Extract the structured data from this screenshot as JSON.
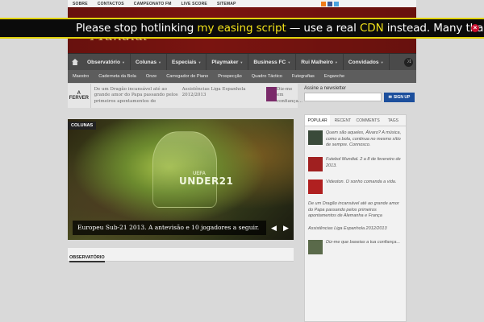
{
  "topbar": {
    "links": [
      "SOBRE",
      "CONTACTOS",
      "CAMPEONATO FM",
      "LIVE SCORE",
      "SITEMAP"
    ],
    "social_icons": [
      {
        "name": "rss-icon",
        "color": "#f07b1a"
      },
      {
        "name": "facebook-icon",
        "color": "#3b5998"
      },
      {
        "name": "twitter-icon",
        "color": "#4aa3df"
      }
    ]
  },
  "header": {
    "logo_text": "Mundial"
  },
  "banner": {
    "part1": "Please stop hotlinking ",
    "link1": "my easing script",
    "part2": " — use a real ",
    "link2": "CDN",
    "part3": " instead. Many thanks",
    "close": "×"
  },
  "nav": {
    "items": [
      "Observatório",
      "Colunas",
      "Especiais",
      "Playmaker",
      "Business FC",
      "Rui Malheiro",
      "Convidados"
    ]
  },
  "subnav": {
    "items": [
      "Maestro",
      "Caderneta da Bola",
      "Onze",
      "Carregador de Piano",
      "Prospecção",
      "Quadro Táctico",
      "Futegrafias",
      "Enganche"
    ]
  },
  "ticker": {
    "label_a": "A",
    "label_b": "FERVER",
    "items": [
      "De um Dragão incansável até ao grande amor do Papa passando pelos primeiros apontamentos de",
      "Assistências Liga Espanhola 2012/2013"
    ],
    "last": "Diz-me em confiança..."
  },
  "newsletter": {
    "title": "Assine a newsletter",
    "button": "SIGN UP"
  },
  "slider": {
    "category": "COLUNAS",
    "uefa": "UEFA",
    "u21": "UNDER21",
    "caption": "Europeu Sub-21 2013. A antevisão e 10 jogadores a seguir.",
    "prev": "◀",
    "next": "▶"
  },
  "section": {
    "title": "OBSERVATÓRIO"
  },
  "sidebar": {
    "tabs": [
      "POPULAR",
      "RECENT",
      "COMMENTS",
      "TAGS"
    ],
    "posts": [
      {
        "text": "Quem são aqueles, Álvaro? A música, como a bola, continua no mesmo sítio de sempre. Connosco.",
        "color": "#3a4a3a"
      },
      {
        "text": "Futebol Mundial. 2 a 8 de fevereiro de 2013.",
        "color": "#a02020"
      },
      {
        "text": "Videoton. O sonho comanda a vida.",
        "color": "#b02020"
      },
      {
        "text": "Diz-me que baseias a tua confiança...",
        "color": "#5a6a4a"
      }
    ],
    "plain": [
      "De um Dragão incansável até ao grande amor do Papa passando pelos primeiros apontamentos de Alemanha e França",
      "Assistências Liga Espanhola 2012/2013"
    ]
  }
}
